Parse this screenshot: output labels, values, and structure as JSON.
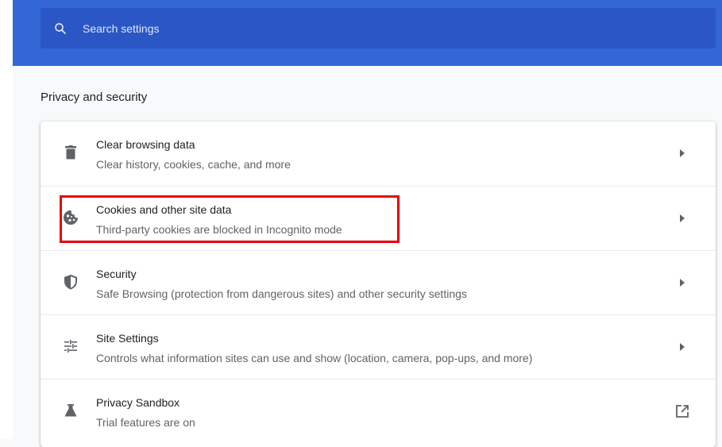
{
  "search": {
    "placeholder": "Search settings"
  },
  "section": {
    "title": "Privacy and security"
  },
  "items": [
    {
      "label": "Clear browsing data",
      "sublabel": "Clear history, cookies, cache, and more",
      "icon": "trash-icon",
      "action": "arrow-right"
    },
    {
      "label": "Cookies and other site data",
      "sublabel": "Third-party cookies are blocked in Incognito mode",
      "icon": "cookie-icon",
      "action": "arrow-right"
    },
    {
      "label": "Security",
      "sublabel": "Safe Browsing (protection from dangerous sites) and other security settings",
      "icon": "shield-icon",
      "action": "arrow-right"
    },
    {
      "label": "Site Settings",
      "sublabel": "Controls what information sites can use and show (location, camera, pop-ups, and more)",
      "icon": "tune-icon",
      "action": "arrow-right"
    },
    {
      "label": "Privacy Sandbox",
      "sublabel": "Trial features are on",
      "icon": "flask-icon",
      "action": "open-in-new"
    }
  ],
  "colors": {
    "header": "#3367d6",
    "search_box": "#2a56c6",
    "highlight": "#e8000b"
  }
}
